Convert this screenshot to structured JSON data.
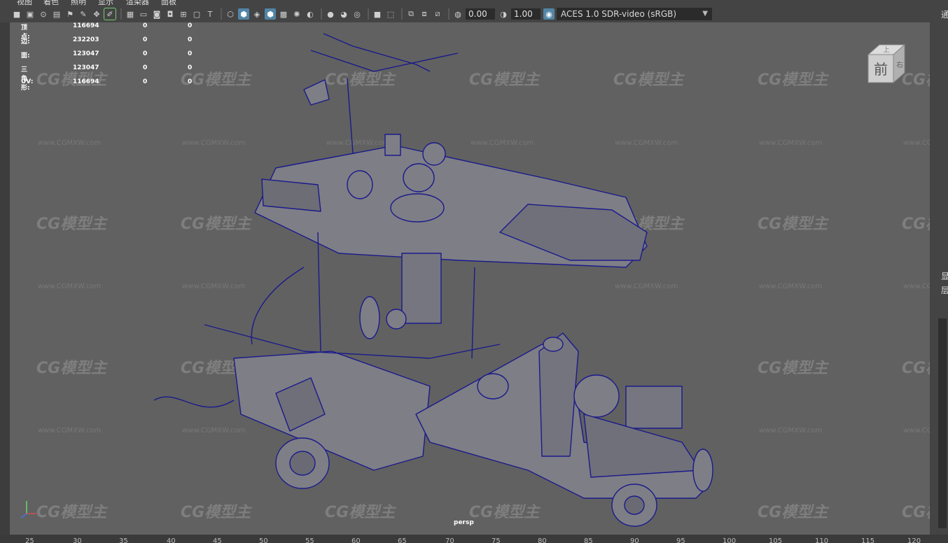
{
  "menu": [
    "视图",
    "着色",
    "照明",
    "显示",
    "渲染器",
    "面板"
  ],
  "toolbar": {
    "exposure": "0.00",
    "gamma": "1.00",
    "color_space": "ACES 1.0 SDR-video (sRGB)"
  },
  "hud": {
    "rows": [
      {
        "label": "顶点:",
        "v1": "116694",
        "v2": "0",
        "v3": "0"
      },
      {
        "label": "边:",
        "v1": "232203",
        "v2": "0",
        "v3": "0"
      },
      {
        "label": "面:",
        "v1": "123047",
        "v2": "0",
        "v3": "0"
      },
      {
        "label": "三角形:",
        "v1": "123047",
        "v2": "0",
        "v3": "0"
      },
      {
        "label": "UV:",
        "v1": "116694",
        "v2": "0",
        "v3": "0"
      }
    ]
  },
  "viewport": {
    "camera_label": "persp",
    "view_cube_face": "前",
    "view_cube_side": "右",
    "view_cube_top": "上"
  },
  "watermark": {
    "brand": "CG模型主",
    "url": "www.CGMXW.com"
  },
  "right_panel": [
    "通",
    "显",
    "层"
  ],
  "ruler": [
    "25",
    "30",
    "35",
    "40",
    "45",
    "50",
    "55",
    "60",
    "65",
    "70",
    "75",
    "80",
    "85",
    "90",
    "95",
    "100",
    "105",
    "110",
    "115",
    "120"
  ],
  "colors": {
    "viewport_bg": "#616161",
    "wireframe": "#1a1a8c",
    "shaded": "#7e7e86",
    "accent": "#5285a6"
  }
}
